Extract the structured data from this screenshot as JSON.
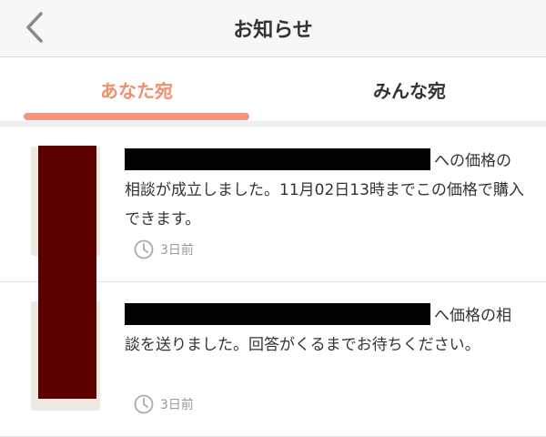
{
  "header": {
    "title": "お知らせ",
    "back_icon": "chevron-left-icon"
  },
  "tabs": [
    {
      "label": "あなた宛",
      "active": true
    },
    {
      "label": "みんな宛",
      "active": false
    }
  ],
  "colors": {
    "accent": "#f0906c",
    "redaction": "#000000",
    "overlay": "#5c0000",
    "muted_text": "#999999"
  },
  "notifications": [
    {
      "text_line1_tail": "への価格の",
      "text_rest": "相談が成立しました。11月02日13時までこの価格で購入できます。",
      "time": "3日前"
    },
    {
      "text_line1_tail": "へ価格の相",
      "text_rest": "談を送りました。回答がくるまでお待ちください。",
      "time": "3日前"
    }
  ]
}
